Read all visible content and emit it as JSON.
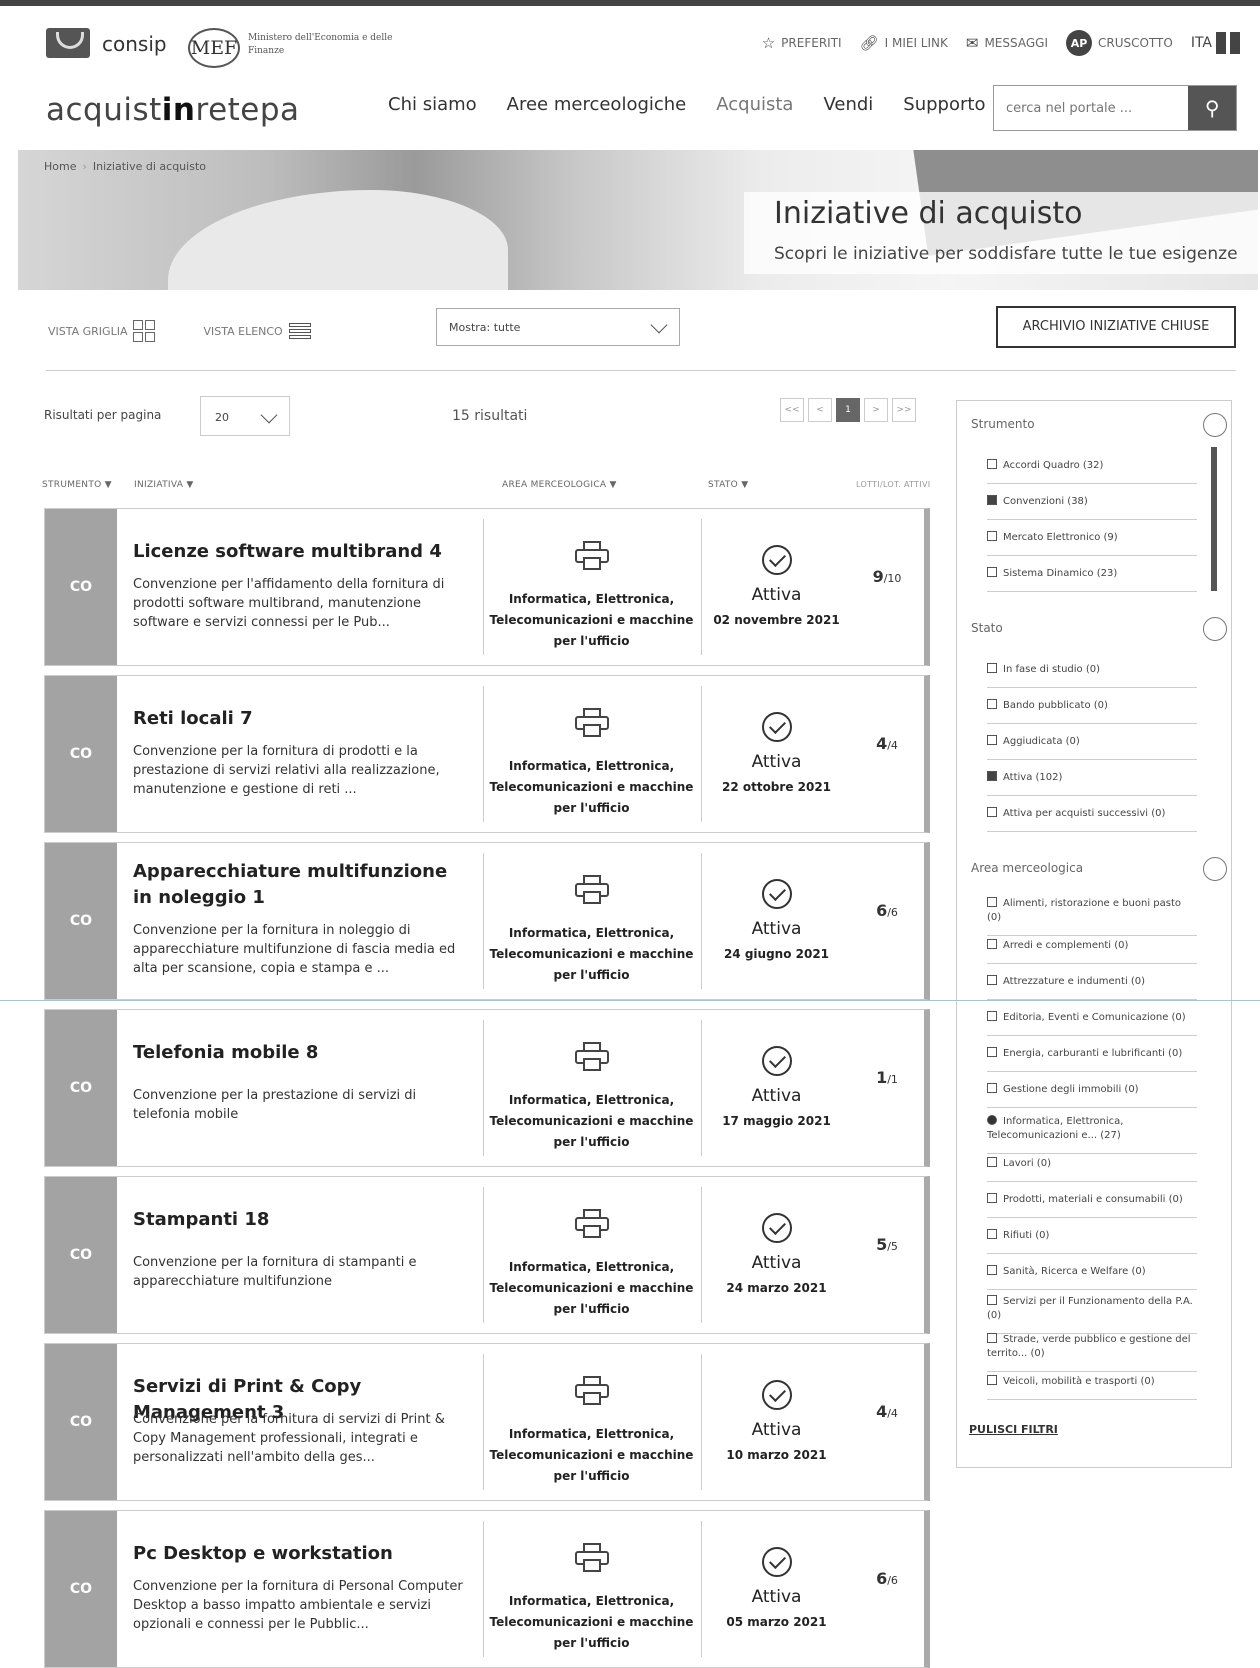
{
  "header": {
    "consip": "consip",
    "mef": "MEF",
    "mef_text": "Ministero dell'Economia e delle Finanze",
    "links": [
      {
        "label": "PREFERITI",
        "icon": "star-icon"
      },
      {
        "label": "I MIEI LINK",
        "icon": "link-icon"
      },
      {
        "label": "MESSAGGI",
        "icon": "mail-icon"
      },
      {
        "label": "CRUSCOTTO",
        "icon": "avatar"
      }
    ],
    "avatar": "AP",
    "lang": "ITA"
  },
  "nav": {
    "brand_a": "acquist",
    "brand_b": "in",
    "brand_c": "retepa",
    "items": [
      "Chi siamo",
      "Aree merceologiche",
      "Acquista",
      "Vendi",
      "Supporto"
    ],
    "search_placeholder": "cerca nel portale ..."
  },
  "breadcrumb": {
    "home": "Home",
    "current": "Iniziative di acquisto"
  },
  "hero": {
    "title": "Iniziative di acquisto",
    "subtitle": "Scopri le iniziative per soddisfare tutte le tue esigenze"
  },
  "controls": {
    "grid_view": "VISTA GRIGLIA",
    "list_view": "VISTA ELENCO",
    "filter_select": "Mostra: tutte",
    "archive_button": "ARCHIVIO INIZIATIVE CHIUSE",
    "results_per_page_label": "Risultati per pagina",
    "results_per_page": "20",
    "results_count": "15 risultati",
    "pager": [
      "<<",
      "<",
      "1",
      ">",
      ">>"
    ]
  },
  "table_headers": {
    "strumento": "STRUMENTO ▼",
    "iniziativa": "INIZIATIVA ▼",
    "area": "AREA MERCEOLOGICA ▼",
    "stato": "STATO ▼",
    "lotti": "LOTTI/LOT. ATTIVI"
  },
  "rows": [
    {
      "badge": "CO",
      "title": "Licenze software multibrand 4",
      "desc": "Convenzione per l'affidamento della fornitura di prodotti software multibrand, manutenzione software e servizi connessi per le Pub...",
      "area": "Informatica, Elettronica, Telecomunicazioni e macchine per l'ufficio",
      "status": "Attiva",
      "date": "02 novembre 2021",
      "lots": "9",
      "lots_total": "/10"
    },
    {
      "badge": "CO",
      "title": "Reti locali 7",
      "desc": "Convenzione per la fornitura di prodotti e la prestazione di servizi relativi alla realizzazione, manutenzione e gestione di reti ...",
      "area": "Informatica, Elettronica, Telecomunicazioni e macchine per l'ufficio",
      "status": "Attiva",
      "date": "22 ottobre 2021",
      "lots": "4",
      "lots_total": "/4"
    },
    {
      "badge": "CO",
      "title": "Apparecchiature multifunzione in noleggio 1",
      "desc": "Convenzione per la fornitura in noleggio di apparecchiature multifunzione di fascia media ed alta per scansione, copia e stampa e ...",
      "area": "Informatica, Elettronica, Telecomunicazioni e macchine per l'ufficio",
      "status": "Attiva",
      "date": "24 giugno 2021",
      "lots": "6",
      "lots_total": "/6"
    },
    {
      "badge": "CO",
      "title": "Telefonia mobile 8",
      "desc": "Convenzione per la prestazione di servizi di telefonia mobile",
      "area": "Informatica, Elettronica, Telecomunicazioni e macchine per l'ufficio",
      "status": "Attiva",
      "date": "17 maggio 2021",
      "lots": "1",
      "lots_total": "/1"
    },
    {
      "badge": "CO",
      "title": "Stampanti 18",
      "desc": "Convenzione per la fornitura di stampanti e apparecchiature multifunzione",
      "area": "Informatica, Elettronica, Telecomunicazioni e macchine per l'ufficio",
      "status": "Attiva",
      "date": "24 marzo 2021",
      "lots": "5",
      "lots_total": "/5"
    },
    {
      "badge": "CO",
      "title": "Servizi di Print & Copy Management 3",
      "desc": "Convenzione per la fornitura di servizi di Print & Copy Management professionali, integrati e personalizzati nell'ambito della ges...",
      "area": "Informatica, Elettronica, Telecomunicazioni e macchine per l'ufficio",
      "status": "Attiva",
      "date": "10 marzo 2021",
      "lots": "4",
      "lots_total": "/4"
    },
    {
      "badge": "CO",
      "title": "Pc Desktop e workstation",
      "desc": "Convenzione per la fornitura di Personal Computer Desktop a basso impatto ambientale e servizi opzionali e connessi per le Pubblic...",
      "area": "Informatica, Elettronica, Telecomunicazioni e macchine per l'ufficio",
      "status": "Attiva",
      "date": "05 marzo 2021",
      "lots": "6",
      "lots_total": "/6"
    }
  ],
  "sidebar": {
    "strumento_title": "Strumento",
    "strumento": [
      {
        "label": "Accordi Quadro (32)",
        "checked": false
      },
      {
        "label": "Convenzioni (38)",
        "checked": true
      },
      {
        "label": "Mercato Elettronico (9)",
        "checked": false
      },
      {
        "label": "Sistema Dinamico (23)",
        "checked": false
      }
    ],
    "stato_title": "Stato",
    "stato": [
      {
        "label": "In fase di studio (0)",
        "checked": false
      },
      {
        "label": "Bando pubblicato (0)",
        "checked": false
      },
      {
        "label": "Aggiudicata (0)",
        "checked": false
      },
      {
        "label": "Attiva (102)",
        "checked": true
      },
      {
        "label": "Attiva per acquisti successivi (0)",
        "checked": false
      }
    ],
    "area_title": "Area merceologica",
    "area": [
      {
        "label": "Alimenti, ristorazione e buoni pasto (0)",
        "checked": false
      },
      {
        "label": "Arredi e complementi (0)",
        "checked": false
      },
      {
        "label": "Attrezzature e indumenti (0)",
        "checked": false
      },
      {
        "label": "Editoria, Eventi e Comunicazione (0)",
        "checked": false
      },
      {
        "label": "Energia, carburanti e lubrificanti (0)",
        "checked": false
      },
      {
        "label": "Gestione degli immobili (0)",
        "checked": false
      },
      {
        "label": "Informatica, Elettronica, Telecomunicazioni e... (27)",
        "checked": true
      },
      {
        "label": "Lavori (0)",
        "checked": false
      },
      {
        "label": "Prodotti, materiali e consumabili (0)",
        "checked": false
      },
      {
        "label": "Rifiuti (0)",
        "checked": false
      },
      {
        "label": "Sanità, Ricerca e Welfare (0)",
        "checked": false
      },
      {
        "label": "Servizi per il Funzionamento della P.A. (0)",
        "checked": false
      },
      {
        "label": "Strade, verde pubblico e gestione del territo... (0)",
        "checked": false
      },
      {
        "label": "Veicoli, mobilità e trasporti (0)",
        "checked": false
      }
    ],
    "clear": "PULISCI FILTRI"
  }
}
